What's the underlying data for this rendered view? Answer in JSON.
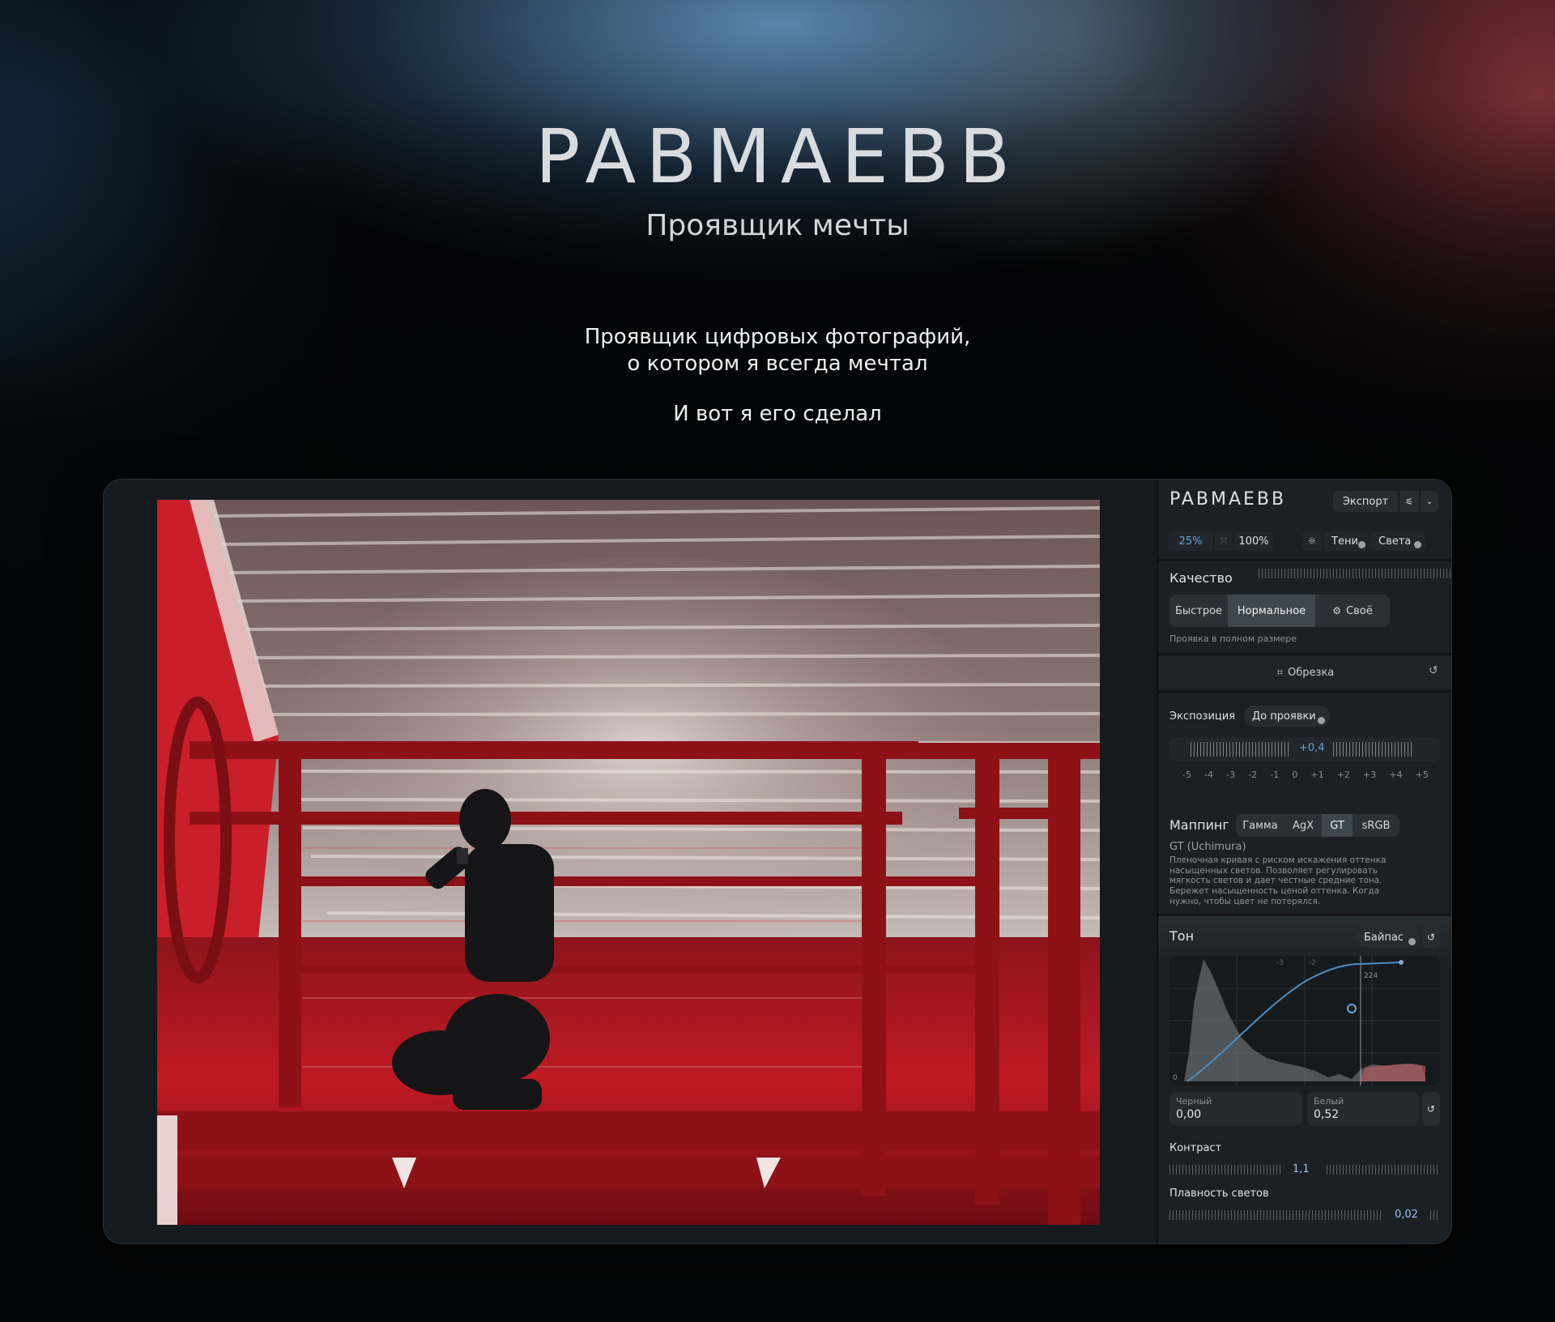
{
  "hero": {
    "logo": "PABMAEBB",
    "tagline": "Проявщик мечты",
    "description_line1": "Проявщик цифровых фотографий,",
    "description_line2": "о котором я всегда мечтал",
    "description_line3": "И вот я его сделал"
  },
  "app": {
    "logo": "PABMAEBB",
    "export_label": "Экспорт",
    "zoom": {
      "fit": "25%",
      "full": "100%"
    },
    "clip_toggles": {
      "shadows": "Тени",
      "highlights": "Света"
    },
    "quality": {
      "title": "Качество",
      "options": [
        "Быстрое",
        "Нормальное",
        "Своё"
      ],
      "selected": "Нормальное",
      "hint": "Проявка в полном размере"
    },
    "crop": {
      "label": "Обрезка"
    },
    "exposure": {
      "title": "Экспозиция",
      "toggle_label": "До проявки",
      "value": "+0,4",
      "scale": [
        "-5",
        "-4",
        "-3",
        "-2",
        "-1",
        "0",
        "+1",
        "+2",
        "+3",
        "+4",
        "+5"
      ]
    },
    "mapping": {
      "title": "Маппинг",
      "options": [
        "Гамма",
        "AgX",
        "GT",
        "sRGB"
      ],
      "selected": "GT",
      "name": "GT (Uchimura)",
      "description1": "Пленочная кривая с риском искажения оттенка насыщенных светов. Позволяет регулировать мягкость светов и дает честные средние тона.",
      "description2": "Бережет насыщенность ценой оттенка. Когда нужно, чтобы цвет не потерялся."
    },
    "tone": {
      "title": "Тон",
      "bypass_label": "Байпас",
      "graph_labels": {
        "top_a": "-3",
        "top_b": "-2",
        "marker": "224",
        "zero": "0"
      },
      "black": {
        "label": "Черный",
        "value": "0,00"
      },
      "white": {
        "label": "Белый",
        "value": "0,52"
      },
      "contrast": {
        "label": "Контраст",
        "value": "1,1"
      },
      "highlight_rolloff": {
        "label": "Плавность светов",
        "value": "0,02"
      }
    },
    "colors": {
      "accent": "#6aa3d8",
      "panel": "#1b2024",
      "photo_red": "#b01822"
    }
  }
}
